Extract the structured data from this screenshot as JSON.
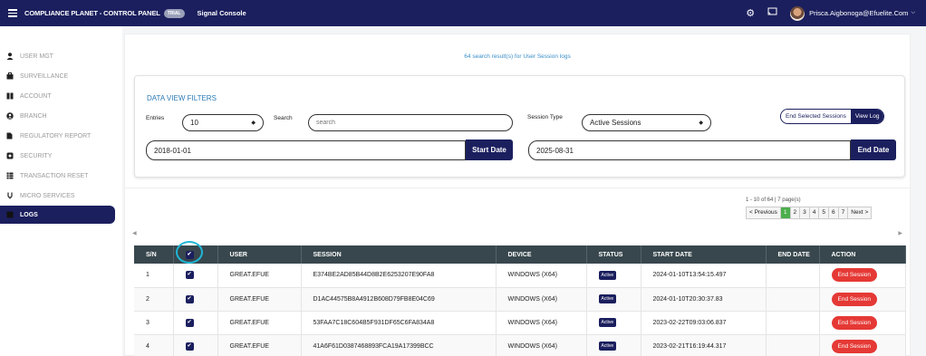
{
  "topbar": {
    "brand": "COMPLIANCE PLANET - CONTROL PANEL",
    "trial_badge": "TRIAL",
    "console": "Signal Console",
    "user_email": "Prisca.Aigbonoga@Efuelite.Com",
    "icons": [
      "gear-icon",
      "cast-icon",
      "avatar",
      "chevron-down-icon"
    ]
  },
  "sidebar": {
    "items": [
      {
        "label": "USER MGT",
        "icon": "user-icon"
      },
      {
        "label": "SURVEILLANCE",
        "icon": "briefcase-icon"
      },
      {
        "label": "ACCOUNT",
        "icon": "book-icon"
      },
      {
        "label": "BRANCH",
        "icon": "user-circle-icon"
      },
      {
        "label": "REGULATORY REPORT",
        "icon": "file-icon"
      },
      {
        "label": "SECURITY",
        "icon": "shield-icon"
      },
      {
        "label": "TRANSACTION RESET",
        "icon": "table-icon"
      },
      {
        "label": "MICRO SERVICES",
        "icon": "plug-icon"
      },
      {
        "label": "LOGS",
        "icon": "list-icon",
        "active": true
      }
    ]
  },
  "main": {
    "result_count": "64 search result(s) for User Session logs",
    "filters": {
      "title": "DATA VIEW FILTERS",
      "entries_label": "Entries",
      "entries_value": "10",
      "search_label": "Search",
      "search_placeholder": "search",
      "session_type_label": "Session Type",
      "session_type_value": "Active Sessions",
      "toggle_end_selected": "End Selected Sessions",
      "toggle_view_log": "View Log",
      "start_date_value": "2018-01-01",
      "start_date_button": "Start Date",
      "end_date_value": "2025-08-31",
      "end_date_button": "End Date"
    },
    "pagination": {
      "info": "1 - 10 of 64 | 7 page(s)",
      "previous": "< Previous",
      "pages": [
        "1",
        "2",
        "3",
        "4",
        "5",
        "6",
        "7"
      ],
      "current_page": "1",
      "next": "Next >"
    },
    "table": {
      "headers": [
        "S/N",
        "✔",
        "USER",
        "SESSION",
        "DEVICE",
        "STATUS",
        "START DATE",
        "END DATE",
        "ACTION"
      ],
      "rows": [
        {
          "sn": "1",
          "user": "GREAT.EFUE",
          "session": "E374BE2AD85B44D8B2E6253207E90FA8",
          "device": "WINDOWS (X64)",
          "status": "Active",
          "start": "2024-01-10T13:54:15.497",
          "end": "",
          "action": "End Session"
        },
        {
          "sn": "2",
          "user": "GREAT.EFUE",
          "session": "D1AC44575B8A4912B608D79FB8E04C69",
          "device": "WINDOWS (X64)",
          "status": "Active",
          "start": "2024-01-10T20:30:37.83",
          "end": "",
          "action": "End Session"
        },
        {
          "sn": "3",
          "user": "GREAT.EFUE",
          "session": "53FAA7C18C604B5F931DF65C6FA834A8",
          "device": "WINDOWS (X64)",
          "status": "Active",
          "start": "2023-02-22T09:03:06.837",
          "end": "",
          "action": "End Session"
        },
        {
          "sn": "4",
          "user": "GREAT.EFUE",
          "session": "41A6F61D0387468893FCA19A17399BCC",
          "device": "WINDOWS (X64)",
          "status": "Active",
          "start": "2023-02-21T16:19:44.317",
          "end": "",
          "action": "End Session"
        }
      ]
    }
  },
  "colors": {
    "navy": "#1b1f5e",
    "table_header": "#38474d",
    "danger": "#e53935",
    "highlight": "#1fb6d6",
    "link_blue": "#3a8ec8",
    "pager_active": "#4cae4c"
  }
}
